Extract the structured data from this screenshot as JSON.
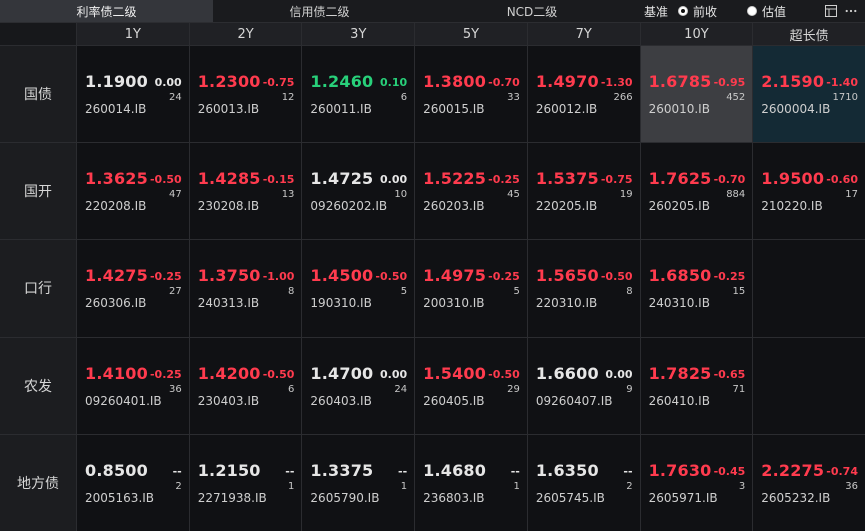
{
  "tabs": [
    {
      "label": "利率债二级",
      "active": true
    },
    {
      "label": "信用债二级",
      "active": false
    },
    {
      "label": "NCD二级",
      "active": false
    }
  ],
  "controls": {
    "basis_label": "基准",
    "options": [
      {
        "label": "前收",
        "selected": true
      },
      {
        "label": "估值",
        "selected": false
      }
    ],
    "icons": [
      "layout-icon",
      "more-icon"
    ]
  },
  "columns": [
    "1Y",
    "2Y",
    "3Y",
    "5Y",
    "7Y",
    "10Y",
    "超长债"
  ],
  "rows": [
    {
      "name": "国债",
      "cells": [
        {
          "yield": "1.1900",
          "change": "0.00",
          "count": "24",
          "code": "260014.IB",
          "color": "white"
        },
        {
          "yield": "1.2300",
          "change": "-0.75",
          "count": "12",
          "code": "260013.IB",
          "color": "red"
        },
        {
          "yield": "1.2460",
          "change": "0.10",
          "count": "6",
          "code": "260011.IB",
          "color": "green"
        },
        {
          "yield": "1.3800",
          "change": "-0.70",
          "count": "33",
          "code": "260015.IB",
          "color": "red"
        },
        {
          "yield": "1.4970",
          "change": "-1.30",
          "count": "266",
          "code": "260012.IB",
          "color": "red"
        },
        {
          "yield": "1.6785",
          "change": "-0.95",
          "count": "452",
          "code": "260010.IB",
          "color": "red",
          "highlight": "grey"
        },
        {
          "yield": "2.1590",
          "change": "-1.40",
          "count": "1710",
          "code": "2600004.IB",
          "color": "red",
          "highlight": "teal"
        }
      ]
    },
    {
      "name": "国开",
      "cells": [
        {
          "yield": "1.3625",
          "change": "-0.50",
          "count": "47",
          "code": "220208.IB",
          "color": "red"
        },
        {
          "yield": "1.4285",
          "change": "-0.15",
          "count": "13",
          "code": "230208.IB",
          "color": "red"
        },
        {
          "yield": "1.4725",
          "change": "0.00",
          "count": "10",
          "code": "09260202.IB",
          "color": "white"
        },
        {
          "yield": "1.5225",
          "change": "-0.25",
          "count": "45",
          "code": "260203.IB",
          "color": "red"
        },
        {
          "yield": "1.5375",
          "change": "-0.75",
          "count": "19",
          "code": "220205.IB",
          "color": "red"
        },
        {
          "yield": "1.7625",
          "change": "-0.70",
          "count": "884",
          "code": "260205.IB",
          "color": "red"
        },
        {
          "yield": "1.9500",
          "change": "-0.60",
          "count": "17",
          "code": "210220.IB",
          "color": "red"
        }
      ]
    },
    {
      "name": "口行",
      "cells": [
        {
          "yield": "1.4275",
          "change": "-0.25",
          "count": "27",
          "code": "260306.IB",
          "color": "red"
        },
        {
          "yield": "1.3750",
          "change": "-1.00",
          "count": "8",
          "code": "240313.IB",
          "color": "red"
        },
        {
          "yield": "1.4500",
          "change": "-0.50",
          "count": "5",
          "code": "190310.IB",
          "color": "red"
        },
        {
          "yield": "1.4975",
          "change": "-0.25",
          "count": "5",
          "code": "200310.IB",
          "color": "red"
        },
        {
          "yield": "1.5650",
          "change": "-0.50",
          "count": "8",
          "code": "220310.IB",
          "color": "red"
        },
        {
          "yield": "1.6850",
          "change": "-0.25",
          "count": "15",
          "code": "240310.IB",
          "color": "red"
        },
        null
      ]
    },
    {
      "name": "农发",
      "cells": [
        {
          "yield": "1.4100",
          "change": "-0.25",
          "count": "36",
          "code": "09260401.IB",
          "color": "red"
        },
        {
          "yield": "1.4200",
          "change": "-0.50",
          "count": "6",
          "code": "230403.IB",
          "color": "red"
        },
        {
          "yield": "1.4700",
          "change": "0.00",
          "count": "24",
          "code": "260403.IB",
          "color": "white"
        },
        {
          "yield": "1.5400",
          "change": "-0.50",
          "count": "29",
          "code": "260405.IB",
          "color": "red"
        },
        {
          "yield": "1.6600",
          "change": "0.00",
          "count": "9",
          "code": "09260407.IB",
          "color": "white"
        },
        {
          "yield": "1.7825",
          "change": "-0.65",
          "count": "71",
          "code": "260410.IB",
          "color": "red"
        },
        null
      ]
    },
    {
      "name": "地方债",
      "cells": [
        {
          "yield": "0.8500",
          "change": "--",
          "count": "2",
          "code": "2005163.IB",
          "color": "white"
        },
        {
          "yield": "1.2150",
          "change": "--",
          "count": "1",
          "code": "2271938.IB",
          "color": "white"
        },
        {
          "yield": "1.3375",
          "change": "--",
          "count": "1",
          "code": "2605790.IB",
          "color": "white"
        },
        {
          "yield": "1.4680",
          "change": "--",
          "count": "1",
          "code": "236803.IB",
          "color": "white"
        },
        {
          "yield": "1.6350",
          "change": "--",
          "count": "2",
          "code": "2605745.IB",
          "color": "white"
        },
        {
          "yield": "1.7630",
          "change": "-0.45",
          "count": "3",
          "code": "2605971.IB",
          "color": "red"
        },
        {
          "yield": "2.2275",
          "change": "-0.74",
          "count": "36",
          "code": "2605232.IB",
          "color": "red"
        }
      ]
    }
  ]
}
